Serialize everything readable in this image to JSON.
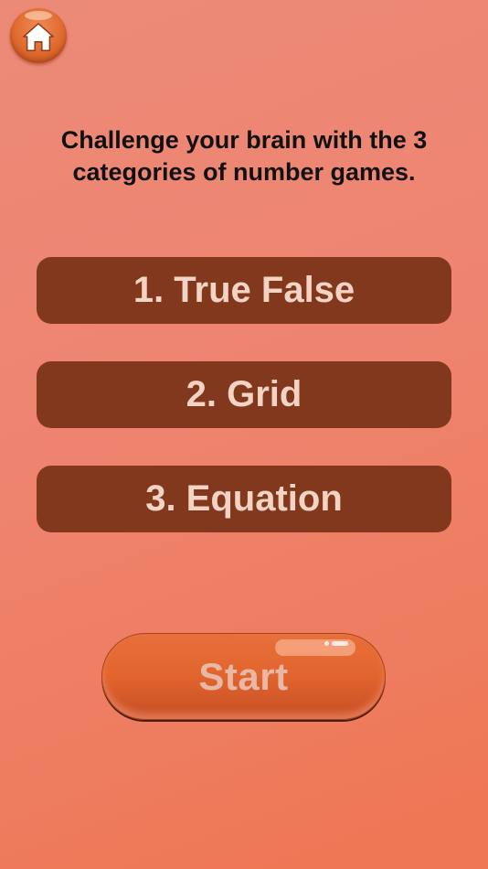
{
  "header": {
    "home_icon": "home-icon"
  },
  "intro": {
    "description": "Challenge your brain with the 3 categories of number games."
  },
  "categories": [
    {
      "label": "1. True False"
    },
    {
      "label": "2. Grid"
    },
    {
      "label": "3. Equation"
    }
  ],
  "actions": {
    "start_label": "Start"
  },
  "colors": {
    "background": "#ee8470",
    "category_button": "#82381d",
    "category_text": "#f3d3c4",
    "start_button": "#e2642e",
    "start_text": "#e9b8a4"
  }
}
